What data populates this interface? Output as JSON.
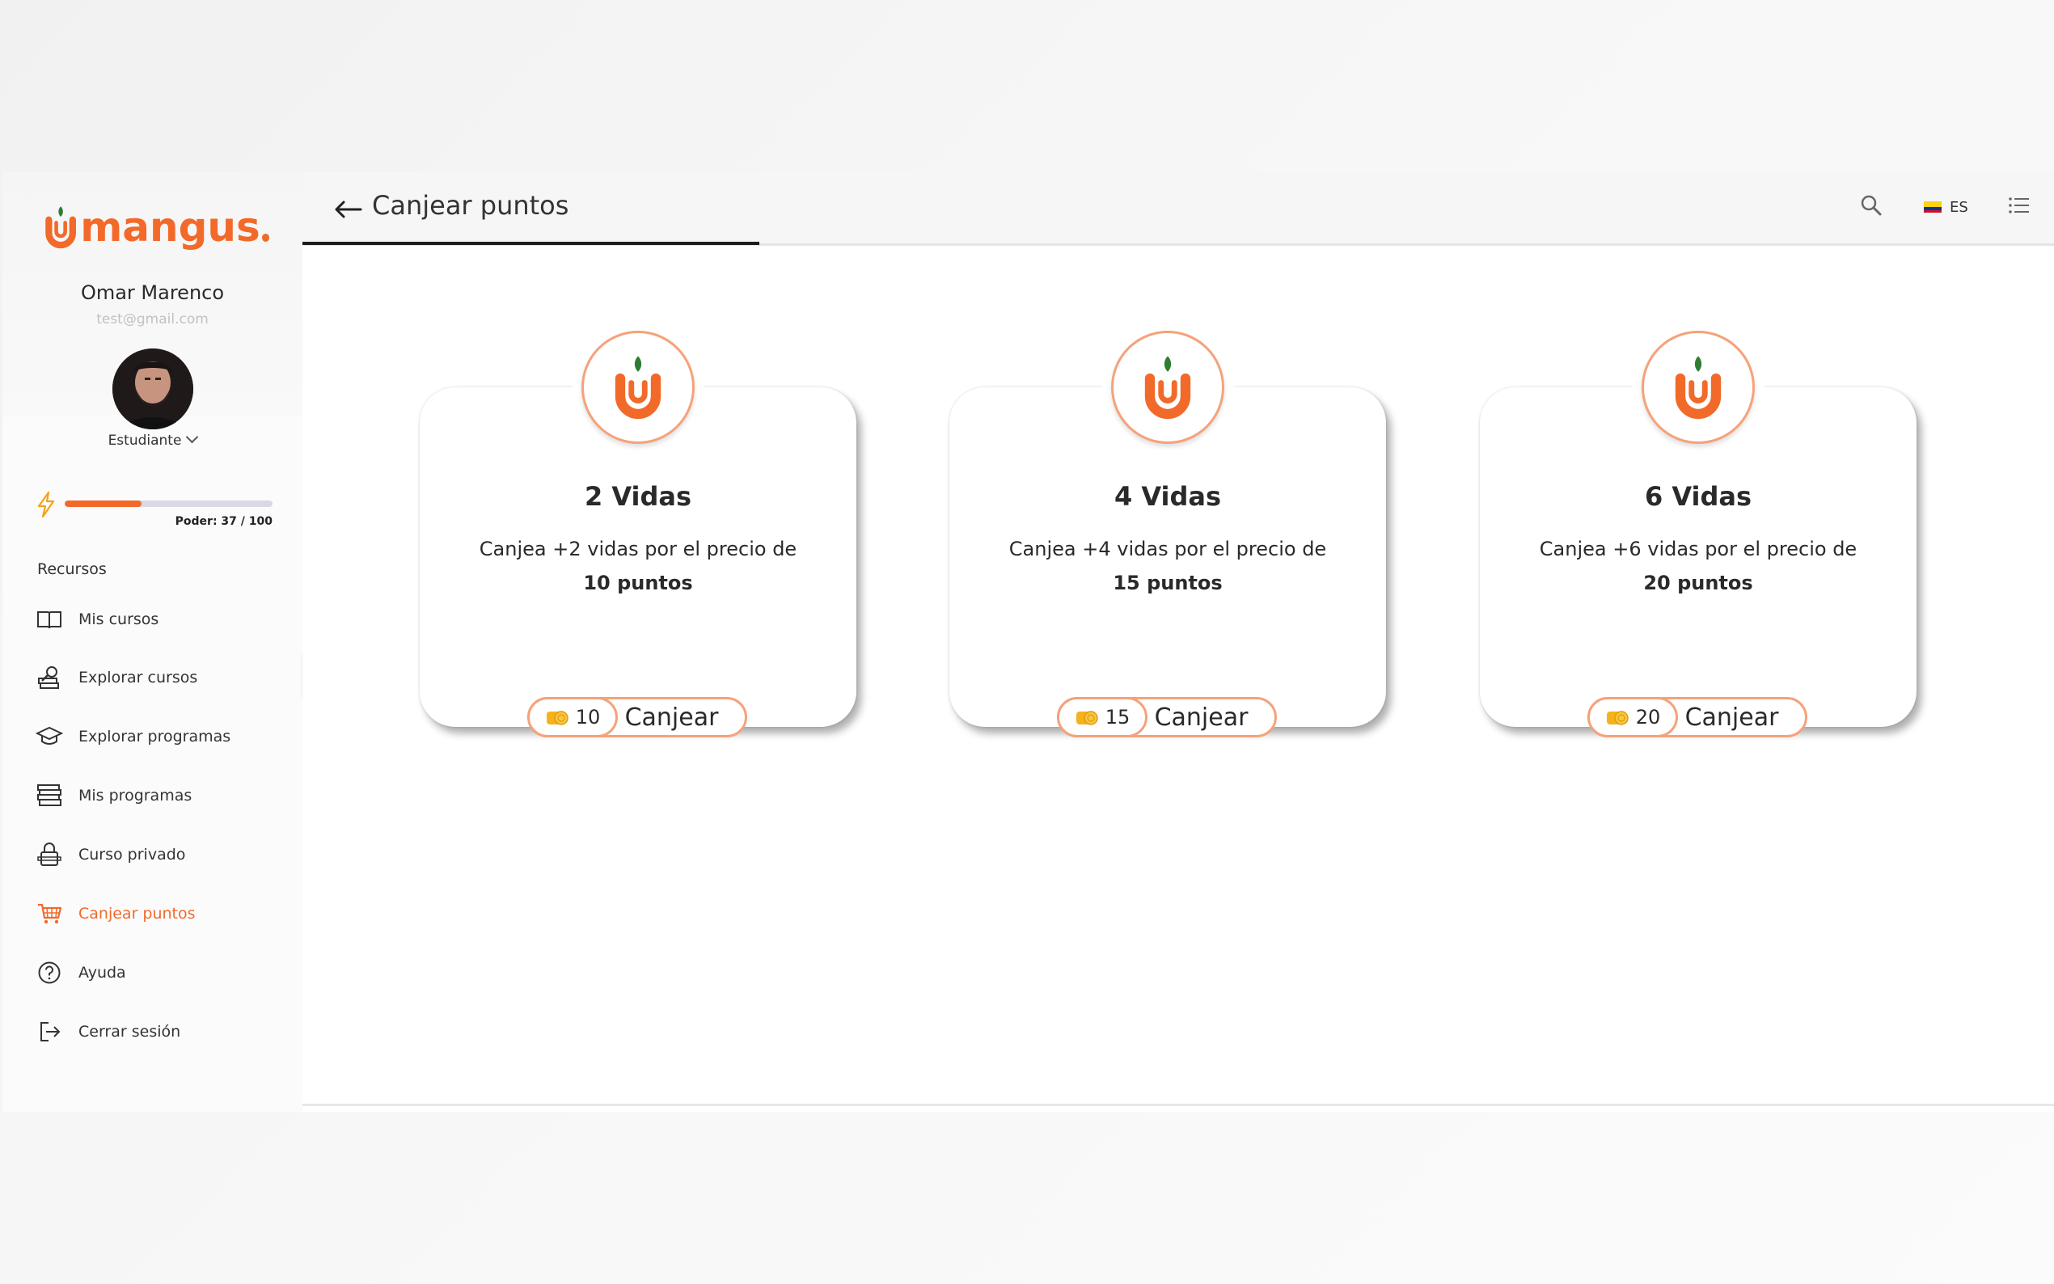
{
  "brand": {
    "name": "mangus",
    "accent_color": "#f26a2a"
  },
  "user": {
    "name": "Omar Marenco",
    "email": "test@gmail.com",
    "role": "Estudiante"
  },
  "power": {
    "label": "Poder: 37 / 100",
    "value": 37,
    "max": 100
  },
  "sidebar": {
    "section_title": "Recursos",
    "items": [
      {
        "label": "Mis cursos",
        "icon": "book-icon"
      },
      {
        "label": "Explorar cursos",
        "icon": "search-books-icon"
      },
      {
        "label": "Explorar programas",
        "icon": "graduation-cap-icon"
      },
      {
        "label": "Mis programas",
        "icon": "stacked-books-icon"
      },
      {
        "label": "Curso privado",
        "icon": "private-course-icon"
      },
      {
        "label": "Canjear puntos",
        "icon": "cart-icon",
        "active": true
      },
      {
        "label": "Ayuda",
        "icon": "help-icon"
      },
      {
        "label": "Cerrar sesión",
        "icon": "logout-icon"
      }
    ]
  },
  "header": {
    "title": "Canjear puntos",
    "lang": "ES"
  },
  "cards": [
    {
      "title": "2 Vidas",
      "description": "Canjea +2 vidas por el precio de",
      "points": "10 puntos",
      "cost": "10",
      "button": "Canjear"
    },
    {
      "title": "4 Vidas",
      "description": "Canjea +4 vidas por el precio de",
      "points": "15 puntos",
      "cost": "15",
      "button": "Canjear"
    },
    {
      "title": "6 Vidas",
      "description": "Canjea +6 vidas por el precio de",
      "points": "20 puntos",
      "cost": "20",
      "button": "Canjear"
    }
  ]
}
